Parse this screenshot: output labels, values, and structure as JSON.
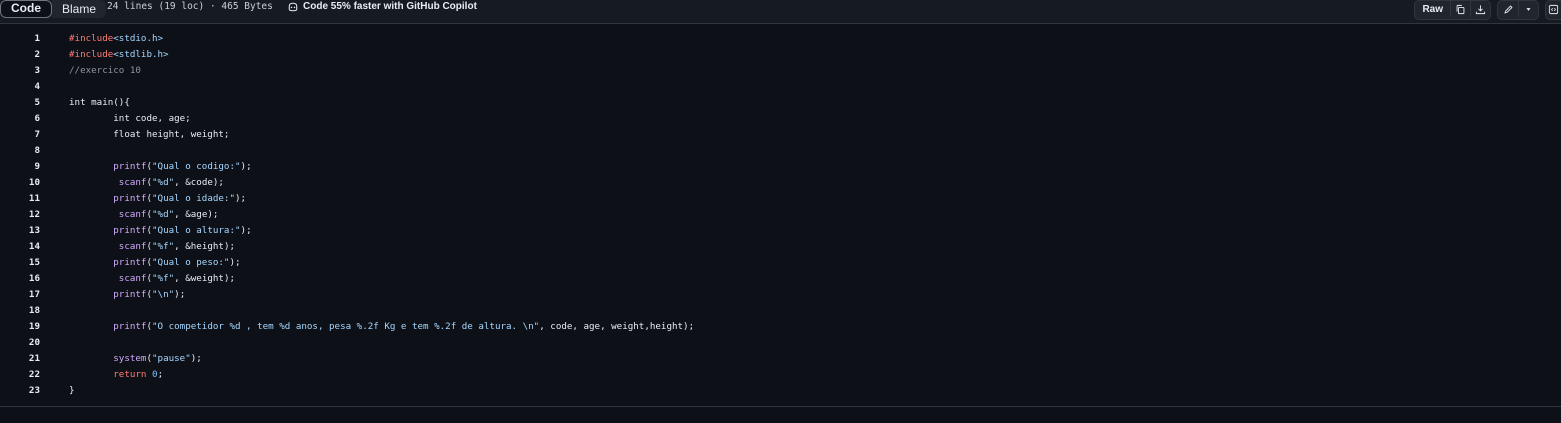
{
  "toolbar": {
    "code_tab": "Code",
    "blame_tab": "Blame",
    "file_info": "24 lines (19 loc) · 465 Bytes",
    "copilot_text": "Code 55% faster with GitHub Copilot",
    "raw_label": "Raw",
    "icons": [
      "copy-icon",
      "download-icon",
      "pencil-icon",
      "triangle-down-icon",
      "code-square-icon"
    ]
  },
  "colors": {
    "background": "#0d1117",
    "preprocessor": "#ff7b72",
    "function": "#d2a8ff",
    "string": "#a5d6ff",
    "number": "#79c0ff",
    "comment": "#8b949e"
  },
  "lines": [
    {
      "n": "1",
      "tokens": [
        {
          "t": "#include",
          "c": "preprocessor"
        },
        {
          "t": "<stdio.h>",
          "c": "string"
        }
      ]
    },
    {
      "n": "2",
      "tokens": [
        {
          "t": "#include",
          "c": "preprocessor"
        },
        {
          "t": "<stdlib.h>",
          "c": "string"
        }
      ]
    },
    {
      "n": "3",
      "tokens": [
        {
          "t": "//exercico 10",
          "c": "comment"
        }
      ]
    },
    {
      "n": "4",
      "tokens": []
    },
    {
      "n": "5",
      "tokens": [
        {
          "t": "int main(){",
          "c": "plain"
        }
      ]
    },
    {
      "n": "6",
      "tokens": [
        {
          "t": "        int code, age;",
          "c": "plain"
        }
      ]
    },
    {
      "n": "7",
      "tokens": [
        {
          "t": "        float height, weight;",
          "c": "plain"
        }
      ]
    },
    {
      "n": "8",
      "tokens": []
    },
    {
      "n": "9",
      "tokens": [
        {
          "t": "        ",
          "c": "plain"
        },
        {
          "t": "printf",
          "c": "function"
        },
        {
          "t": "(",
          "c": "plain"
        },
        {
          "t": "\"Qual o codigo:\"",
          "c": "string"
        },
        {
          "t": ");",
          "c": "plain"
        }
      ]
    },
    {
      "n": "10",
      "tokens": [
        {
          "t": "         ",
          "c": "plain"
        },
        {
          "t": "scanf",
          "c": "function"
        },
        {
          "t": "(",
          "c": "plain"
        },
        {
          "t": "\"%d\"",
          "c": "string"
        },
        {
          "t": ", &code);",
          "c": "plain"
        }
      ]
    },
    {
      "n": "11",
      "tokens": [
        {
          "t": "        ",
          "c": "plain"
        },
        {
          "t": "printf",
          "c": "function"
        },
        {
          "t": "(",
          "c": "plain"
        },
        {
          "t": "\"Qual o idade:\"",
          "c": "string"
        },
        {
          "t": ");",
          "c": "plain"
        }
      ]
    },
    {
      "n": "12",
      "tokens": [
        {
          "t": "         ",
          "c": "plain"
        },
        {
          "t": "scanf",
          "c": "function"
        },
        {
          "t": "(",
          "c": "plain"
        },
        {
          "t": "\"%d\"",
          "c": "string"
        },
        {
          "t": ", &age);",
          "c": "plain"
        }
      ]
    },
    {
      "n": "13",
      "tokens": [
        {
          "t": "        ",
          "c": "plain"
        },
        {
          "t": "printf",
          "c": "function"
        },
        {
          "t": "(",
          "c": "plain"
        },
        {
          "t": "\"Qual o altura:\"",
          "c": "string"
        },
        {
          "t": ");",
          "c": "plain"
        }
      ]
    },
    {
      "n": "14",
      "tokens": [
        {
          "t": "         ",
          "c": "plain"
        },
        {
          "t": "scanf",
          "c": "function"
        },
        {
          "t": "(",
          "c": "plain"
        },
        {
          "t": "\"%f\"",
          "c": "string"
        },
        {
          "t": ", &height);",
          "c": "plain"
        }
      ]
    },
    {
      "n": "15",
      "tokens": [
        {
          "t": "        ",
          "c": "plain"
        },
        {
          "t": "printf",
          "c": "function"
        },
        {
          "t": "(",
          "c": "plain"
        },
        {
          "t": "\"Qual o peso:\"",
          "c": "string"
        },
        {
          "t": ");",
          "c": "plain"
        }
      ]
    },
    {
      "n": "16",
      "tokens": [
        {
          "t": "         ",
          "c": "plain"
        },
        {
          "t": "scanf",
          "c": "function"
        },
        {
          "t": "(",
          "c": "plain"
        },
        {
          "t": "\"%f\"",
          "c": "string"
        },
        {
          "t": ", &weight);",
          "c": "plain"
        }
      ]
    },
    {
      "n": "17",
      "tokens": [
        {
          "t": "        ",
          "c": "plain"
        },
        {
          "t": "printf",
          "c": "function"
        },
        {
          "t": "(",
          "c": "plain"
        },
        {
          "t": "\"\\n\"",
          "c": "string"
        },
        {
          "t": ");",
          "c": "plain"
        }
      ]
    },
    {
      "n": "18",
      "tokens": []
    },
    {
      "n": "19",
      "tokens": [
        {
          "t": "        ",
          "c": "plain"
        },
        {
          "t": "printf",
          "c": "function"
        },
        {
          "t": "(",
          "c": "plain"
        },
        {
          "t": "\"O competidor %d , tem %d anos, pesa %.2f Kg e tem %.2f de altura. \\n\"",
          "c": "string"
        },
        {
          "t": ", code, age, weight,height);",
          "c": "plain"
        }
      ]
    },
    {
      "n": "20",
      "tokens": []
    },
    {
      "n": "21",
      "tokens": [
        {
          "t": "        ",
          "c": "plain"
        },
        {
          "t": "system",
          "c": "function"
        },
        {
          "t": "(",
          "c": "plain"
        },
        {
          "t": "\"pause\"",
          "c": "string"
        },
        {
          "t": ");",
          "c": "plain"
        }
      ]
    },
    {
      "n": "22",
      "tokens": [
        {
          "t": "        ",
          "c": "plain"
        },
        {
          "t": "return",
          "c": "preprocessor"
        },
        {
          "t": " ",
          "c": "plain"
        },
        {
          "t": "0",
          "c": "number"
        },
        {
          "t": ";",
          "c": "plain"
        }
      ]
    },
    {
      "n": "23",
      "tokens": [
        {
          "t": "}",
          "c": "plain"
        }
      ]
    }
  ]
}
